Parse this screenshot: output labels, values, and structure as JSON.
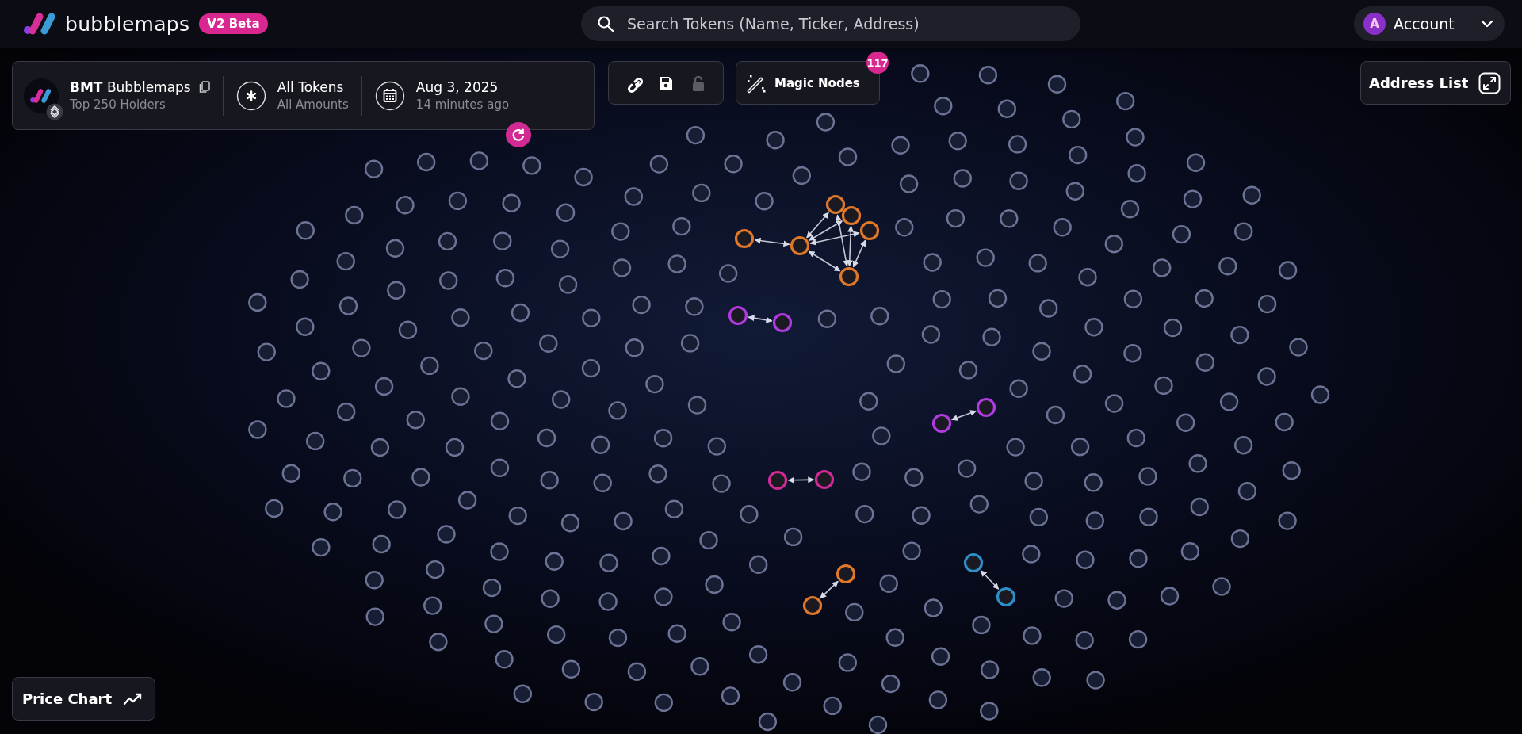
{
  "header": {
    "logo_text": "bubblemaps",
    "version_badge": "V2 Beta",
    "search": {
      "placeholder": "Search Tokens (Name, Ticker, Address)"
    },
    "account": {
      "avatar_letter": "A",
      "label": "Account"
    }
  },
  "token_panel": {
    "ticker": "BMT",
    "name": "Bubblemaps",
    "subtitle": "Top 250 Holders",
    "filter": {
      "title": "All Tokens",
      "subtitle": "All Amounts"
    },
    "date": {
      "title": "Aug 3, 2025",
      "subtitle": "14 minutes ago"
    }
  },
  "toolbar": [
    {
      "kind": "link",
      "disabled": false
    },
    {
      "kind": "save",
      "disabled": false
    },
    {
      "kind": "lock",
      "disabled": true
    }
  ],
  "magic_nodes": {
    "label": "Magic Nodes",
    "count": "117"
  },
  "address_list": {
    "label": "Address List"
  },
  "price_chart": {
    "label": "Price Chart"
  },
  "clusters": [
    {
      "color": "#e0782a"
    },
    {
      "color": "#b13be0"
    },
    {
      "color": "#b13be0"
    },
    {
      "color": "#d02a95"
    },
    {
      "color": "#e0782a"
    },
    {
      "color": "#2e8fc8"
    }
  ]
}
